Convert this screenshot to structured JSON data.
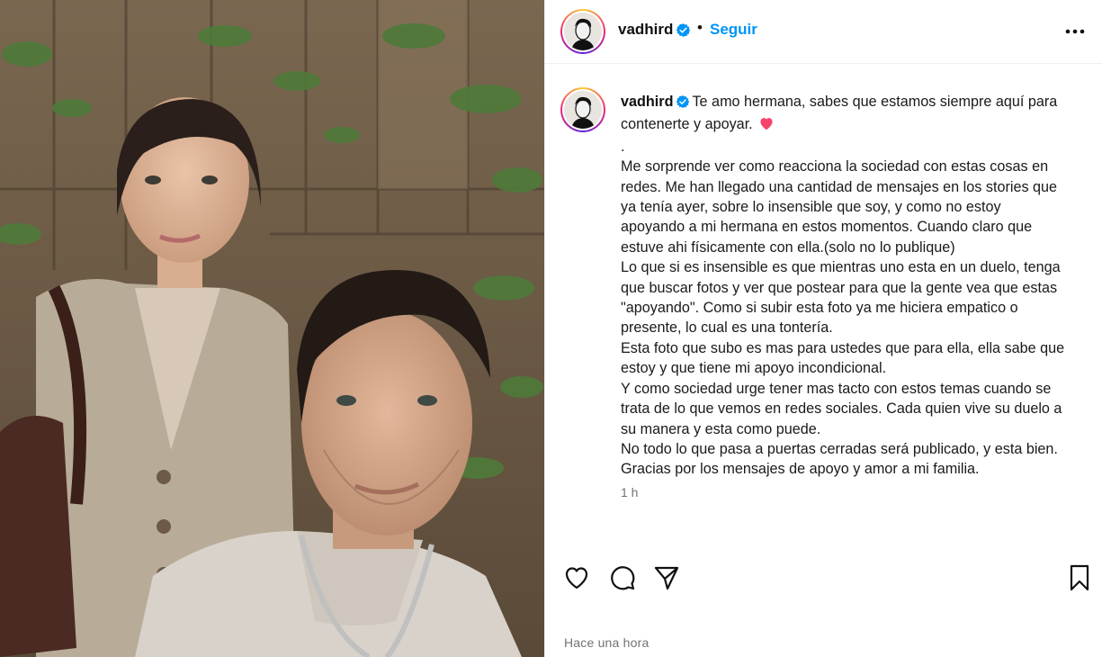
{
  "post": {
    "username": "vadhird",
    "follow_label": "Seguir",
    "separator": "•",
    "caption_lines": [
      "contenerte y apoyar.",
      ".",
      "Me sorprende ver como reacciona la sociedad con estas cosas en",
      "redes. Me han llegado una cantidad de mensajes en los stories que",
      "ya tenía ayer, sobre lo insensible que soy, y como no estoy",
      "apoyando a mi hermana en estos momentos. Cuando claro que",
      "estuve ahi físicamente con ella.(solo no lo publique)",
      "Lo que si es insensible es que mientras uno esta en un duelo, tenga",
      "que buscar fotos y ver que postear para que la gente vea que estas",
      "\"apoyando\". Como si subir esta foto ya me hiciera empatico o",
      "presente, lo cual es una tontería.",
      "Esta foto que subo es mas para ustedes que para ella, ella sabe que",
      "estoy y que tiene mi apoyo incondicional.",
      "Y como sociedad urge tener mas tacto con estos temas cuando se",
      "trata de lo que vemos en redes sociales. Cada quien vive su duelo a",
      "su manera y esta como puede.",
      "No todo lo que pasa a puertas cerradas será publicado, y esta bien.",
      "Gracias por los mensajes de apoyo y amor a mi familia."
    ],
    "caption_first_line": "Te amo hermana, sabes que estamos siempre aquí para",
    "caption_relative_time": "1 h",
    "posted_time": "Hace una hora"
  },
  "icons": {
    "more": "more-horizontal-icon",
    "verified": "verified-badge-icon",
    "like": "heart-icon",
    "comment": "comment-icon",
    "share": "send-icon",
    "save": "bookmark-icon",
    "emoji": "pink-heart-emoji"
  },
  "colors": {
    "link_blue": "#0095f6",
    "verified_blue": "#0095f6",
    "meta_gray": "#737373",
    "heart_pink": "#f4436c"
  }
}
